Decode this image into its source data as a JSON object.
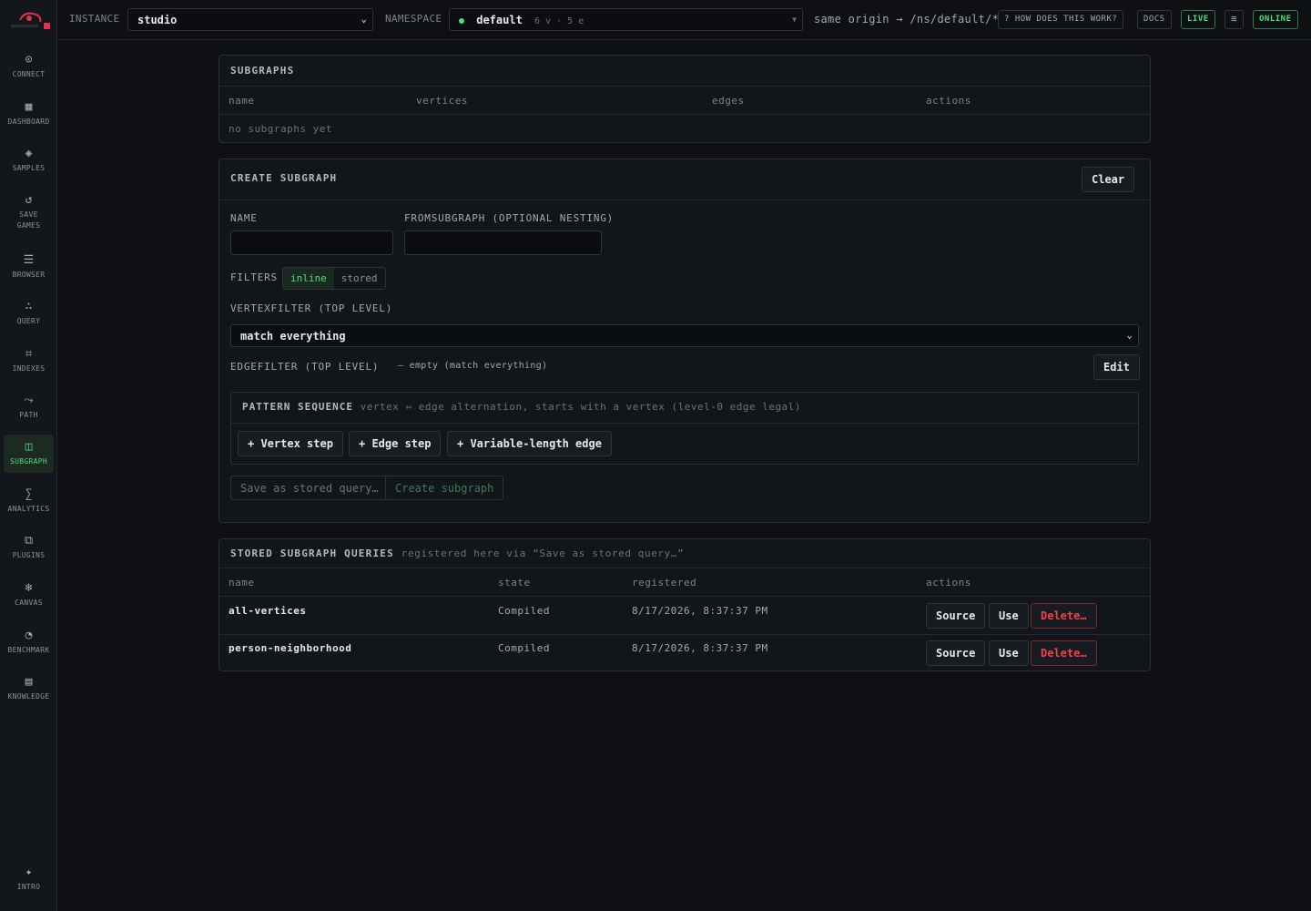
{
  "sidebar": {
    "items": [
      {
        "icon": "⊙",
        "label": "CONNECT"
      },
      {
        "icon": "▦",
        "label": "DASHBOARD"
      },
      {
        "icon": "◈",
        "label": "SAMPLES"
      },
      {
        "icon": "↺",
        "label": "SAVE GAMES"
      },
      {
        "icon": "☰",
        "label": "BROWSER"
      },
      {
        "icon": "∴",
        "label": "QUERY"
      },
      {
        "icon": "⌗",
        "label": "INDEXES"
      },
      {
        "icon": "⤳",
        "label": "PATH"
      },
      {
        "icon": "◫",
        "label": "SUBGRAPH"
      },
      {
        "icon": "∑",
        "label": "ANALYTICS"
      },
      {
        "icon": "⧉",
        "label": "PLUGINS"
      },
      {
        "icon": "❄",
        "label": "CANVAS"
      },
      {
        "icon": "◔",
        "label": "BENCHMARK"
      },
      {
        "icon": "▤",
        "label": "KNOWLEDGE"
      }
    ],
    "intro": {
      "icon": "✦",
      "label": "INTRO"
    },
    "active": "SUBGRAPH"
  },
  "topbar": {
    "instance_label": "INSTANCE",
    "instance_value": "studio",
    "namespace_label": "NAMESPACE",
    "namespace_value": "default",
    "namespace_meta": "6 v · 5 e",
    "origin_text": "same origin → /ns/default/*",
    "how_label": "? HOW DOES THIS WORK?",
    "docs_label": "DOCS",
    "live_label": "LIVE",
    "wave_icon": "≋",
    "online_label": "ONLINE"
  },
  "subgraphs": {
    "title": "SUBGRAPHS",
    "columns": [
      "name",
      "vertices",
      "edges",
      "actions"
    ],
    "empty_text": "no subgraphs yet"
  },
  "create": {
    "title": "CREATE SUBGRAPH",
    "clear_label": "Clear",
    "name_label": "NAME",
    "from_label": "FROMSUBGRAPH (OPTIONAL NESTING)",
    "filters_label": "FILTERS",
    "filter_inline": "inline",
    "filter_stored": "stored",
    "vertexfilter_label": "VERTEXFILTER (TOP LEVEL)",
    "vertexfilter_value": "match everything",
    "edgefilter_label": "EDGEFILTER (TOP LEVEL)",
    "edgefilter_hint": "— empty (match everything)",
    "edit_label": "Edit",
    "pattern_title": "PATTERN SEQUENCE",
    "pattern_hint": "vertex ⇔ edge alternation, starts with a vertex (level-0 edge legal)",
    "vertex_step": "+ Vertex step",
    "edge_step": "+ Edge step",
    "varlen_edge": "+ Variable-length edge",
    "save_stored": "Save as stored query…",
    "create_btn": "Create subgraph"
  },
  "stored": {
    "title": "STORED SUBGRAPH QUERIES",
    "subtitle": "registered here via “Save as stored query…”",
    "columns": [
      "name",
      "state",
      "registered",
      "actions"
    ],
    "rows": [
      {
        "name": "all-vertices",
        "state": "Compiled",
        "registered": "8/17/2026, 8:37:37 PM"
      },
      {
        "name": "person-neighborhood",
        "state": "Compiled",
        "registered": "8/17/2026, 8:37:37 PM"
      }
    ],
    "source_label": "Source",
    "use_label": "Use",
    "delete_label": "Delete…"
  }
}
